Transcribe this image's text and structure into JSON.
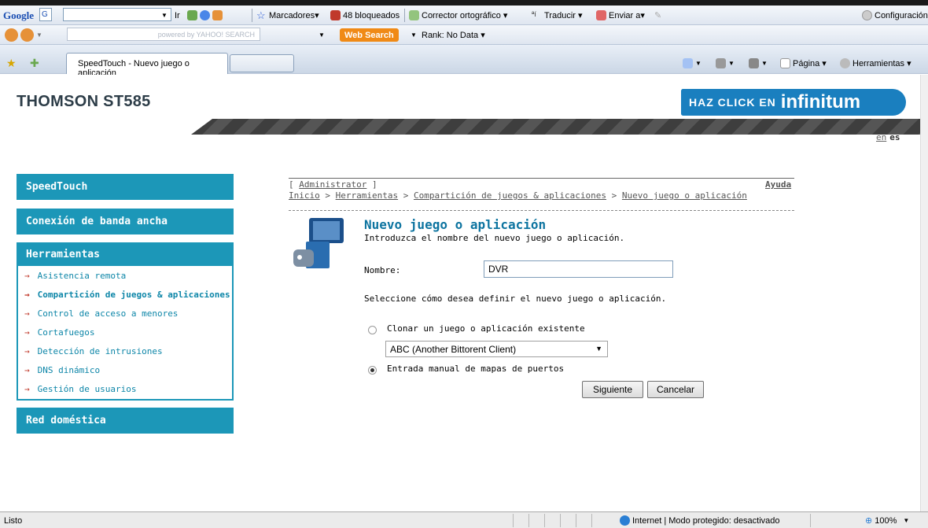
{
  "browser": {
    "google_bar": {
      "logo": "Google",
      "go_label": "Ir",
      "bookmarks_label": "Marcadores▾",
      "blocked_label": "48 bloqueados",
      "spell_label": "Corrector ortográfico ▾",
      "translate_label": "Traducir ▾",
      "send_label": "Enviar a▾",
      "settings_label": "Configuración▾"
    },
    "yahoo_bar": {
      "search_placeholder": "powered by YAHOO! SEARCH",
      "web_search_label": "Web Search",
      "rank_label": "Rank: No Data ▾"
    },
    "tab_title": "SpeedTouch - Nuevo juego o aplicación",
    "cmd": {
      "page_label": "Página ▾",
      "tools_label": "Herramientas ▾"
    },
    "status": {
      "text": "Listo",
      "zone": "Internet | Modo protegido: desactivado",
      "zoom": "100%"
    }
  },
  "page": {
    "header_title": "THOMSON ST585",
    "logo_prefix": "HAZ CLICK EN",
    "logo_brand": "infinitum",
    "lang_en": "en",
    "lang_es": "es",
    "menu": {
      "speedtouch": "SpeedTouch",
      "broadband": "Conexión de banda ancha",
      "tools": "Herramientas",
      "items": [
        "Asistencia remota",
        "Compartición de juegos & aplicaciones",
        "Control de acceso a menores",
        "Cortafuegos",
        "Detección de intrusiones",
        "DNS dinámico",
        "Gestión de usuarios"
      ],
      "home_network": "Red doméstica"
    },
    "breadcrumb": {
      "user": "Administrator",
      "help": "Ayuda",
      "path": [
        "Inicio",
        "Herramientas",
        "Compartición de juegos & aplicaciones",
        "Nuevo juego o aplicación"
      ]
    },
    "form": {
      "title": "Nuevo juego o aplicación",
      "subtitle": "Introduzca el nombre del nuevo juego o aplicación.",
      "name_label": "Nombre:",
      "name_value": "DVR",
      "define_text": "Seleccione cómo desea definir el nuevo juego o aplicación.",
      "option_clone": "Clonar un juego o aplicación existente",
      "clone_select_value": "ABC (Another Bittorent Client)",
      "option_manual": "Entrada manual de mapas de puertos",
      "selected_option": "manual",
      "next_label": "Siguiente",
      "cancel_label": "Cancelar"
    }
  }
}
